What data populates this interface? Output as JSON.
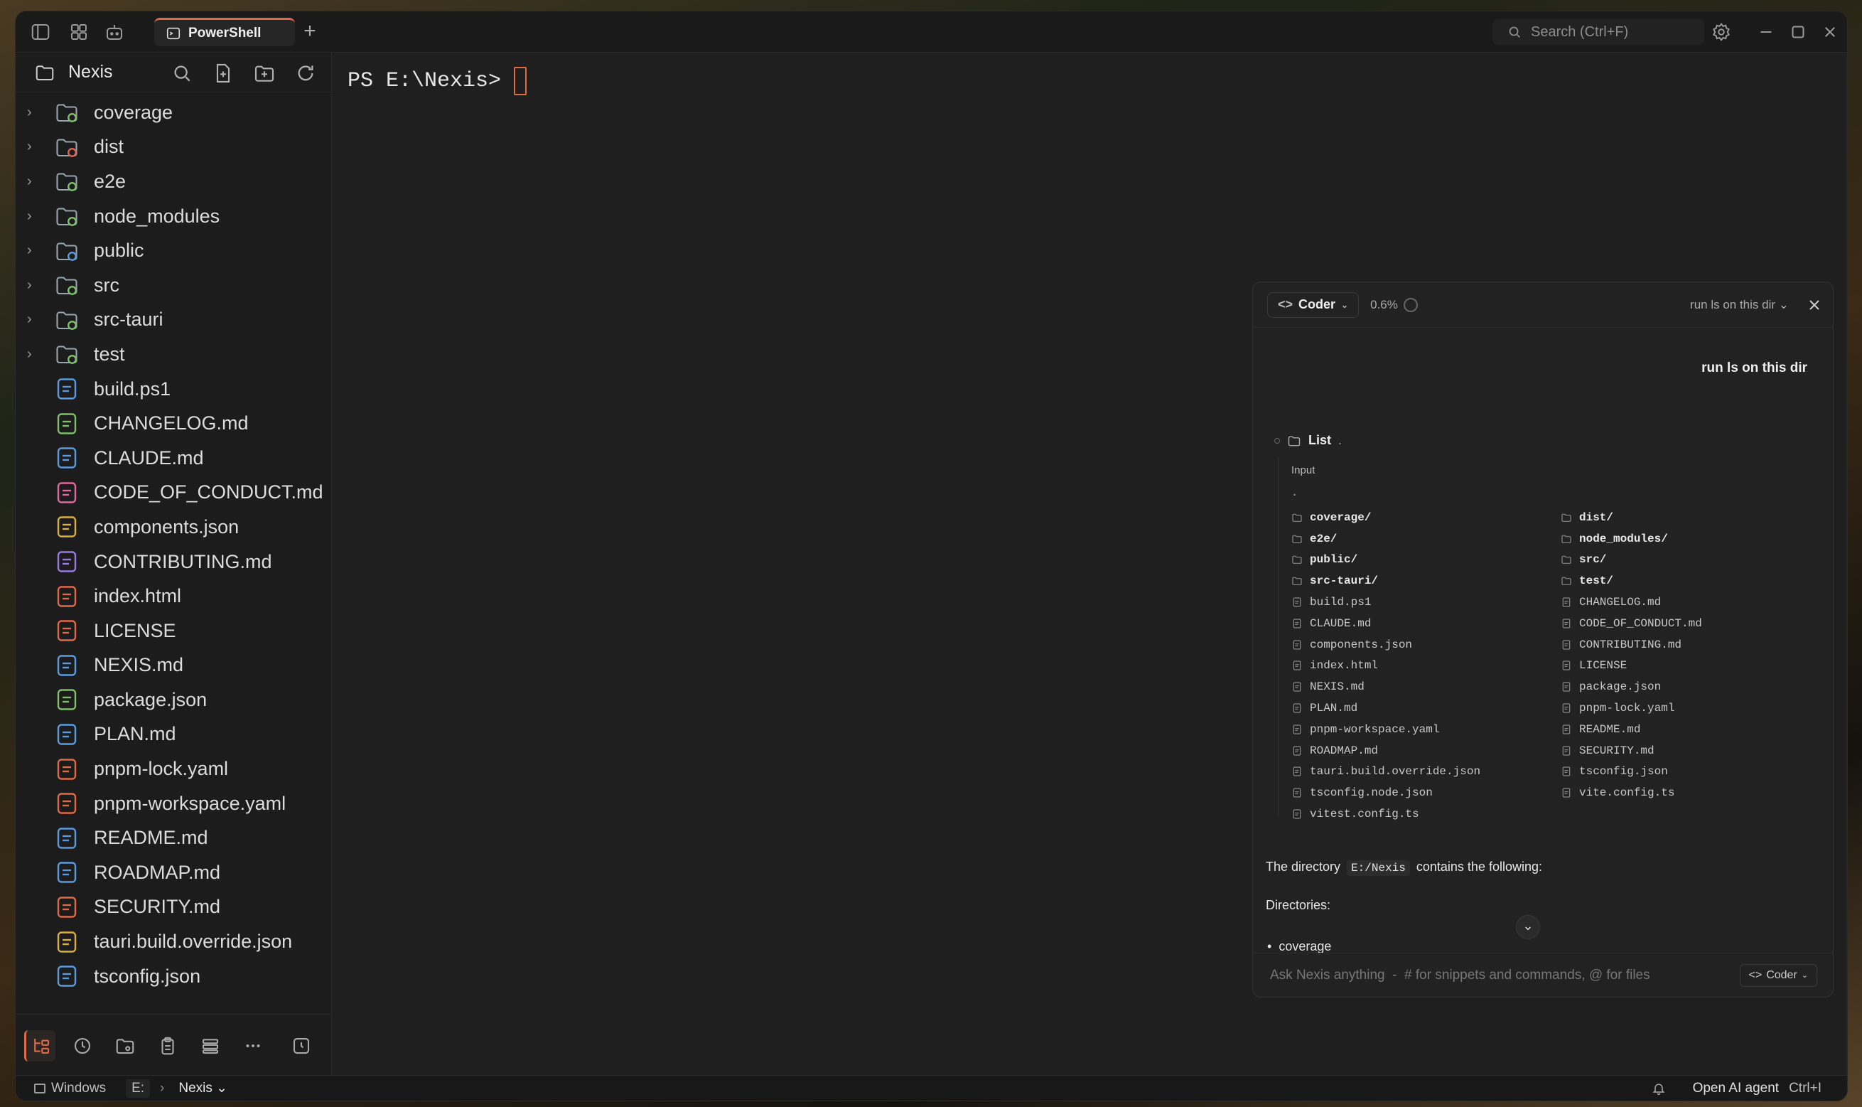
{
  "titlebar": {
    "tab_label": "PowerShell",
    "search_placeholder": "Search (Ctrl+F)"
  },
  "sidebar": {
    "folder_name": "Nexis",
    "items": [
      {
        "name": "coverage",
        "kind": "folder",
        "color": "#7fbf6a"
      },
      {
        "name": "dist",
        "kind": "folder",
        "color": "#e0605a"
      },
      {
        "name": "e2e",
        "kind": "folder",
        "color": "#7fbf6a"
      },
      {
        "name": "node_modules",
        "kind": "folder",
        "color": "#7fbf6a"
      },
      {
        "name": "public",
        "kind": "folder",
        "color": "#5a9be0"
      },
      {
        "name": "src",
        "kind": "folder",
        "color": "#7fbf6a"
      },
      {
        "name": "src-tauri",
        "kind": "folder",
        "color": "#7fbf6a"
      },
      {
        "name": "test",
        "kind": "folder",
        "color": "#7fbf6a"
      },
      {
        "name": "build.ps1",
        "kind": "file",
        "color": "#5a9be0"
      },
      {
        "name": "CHANGELOG.md",
        "kind": "file",
        "color": "#7fbf6a"
      },
      {
        "name": "CLAUDE.md",
        "kind": "file",
        "color": "#5a9be0"
      },
      {
        "name": "CODE_OF_CONDUCT.md",
        "kind": "file",
        "color": "#e06aa0"
      },
      {
        "name": "components.json",
        "kind": "file",
        "color": "#d9b03c"
      },
      {
        "name": "CONTRIBUTING.md",
        "kind": "file",
        "color": "#9a7ae0"
      },
      {
        "name": "index.html",
        "kind": "file",
        "color": "#e06a46"
      },
      {
        "name": "LICENSE",
        "kind": "file",
        "color": "#e06a46"
      },
      {
        "name": "NEXIS.md",
        "kind": "file",
        "color": "#5a9be0"
      },
      {
        "name": "package.json",
        "kind": "file",
        "color": "#7fbf6a"
      },
      {
        "name": "PLAN.md",
        "kind": "file",
        "color": "#5a9be0"
      },
      {
        "name": "pnpm-lock.yaml",
        "kind": "file",
        "color": "#e06a46"
      },
      {
        "name": "pnpm-workspace.yaml",
        "kind": "file",
        "color": "#e06a46"
      },
      {
        "name": "README.md",
        "kind": "file",
        "color": "#5a9be0"
      },
      {
        "name": "ROADMAP.md",
        "kind": "file",
        "color": "#5a9be0"
      },
      {
        "name": "SECURITY.md",
        "kind": "file",
        "color": "#e06a46"
      },
      {
        "name": "tauri.build.override.json",
        "kind": "file",
        "color": "#d9b03c"
      },
      {
        "name": "tsconfig.json",
        "kind": "file",
        "color": "#5a9be0"
      }
    ]
  },
  "terminal": {
    "prompt": "PS E:\\Nexis>"
  },
  "chat": {
    "mode": "Coder",
    "usage": "0.6%",
    "session_title": "run ls on this dir",
    "user_message": "run ls on this dir",
    "tool": {
      "name": "List",
      "arg": ".",
      "input_label": "Input",
      "input_value": "."
    },
    "listing_left": [
      {
        "name": "coverage/",
        "dir": true
      },
      {
        "name": "e2e/",
        "dir": true
      },
      {
        "name": "public/",
        "dir": true
      },
      {
        "name": "src-tauri/",
        "dir": true
      },
      {
        "name": "build.ps1"
      },
      {
        "name": "CLAUDE.md"
      },
      {
        "name": "components.json"
      },
      {
        "name": "index.html"
      },
      {
        "name": "NEXIS.md"
      },
      {
        "name": "PLAN.md"
      },
      {
        "name": "pnpm-workspace.yaml"
      },
      {
        "name": "ROADMAP.md"
      },
      {
        "name": "tauri.build.override.json"
      },
      {
        "name": "tsconfig.node.json"
      },
      {
        "name": "vitest.config.ts"
      }
    ],
    "listing_right": [
      {
        "name": "dist/",
        "dir": true
      },
      {
        "name": "node_modules/",
        "dir": true
      },
      {
        "name": "src/",
        "dir": true
      },
      {
        "name": "test/",
        "dir": true
      },
      {
        "name": "CHANGELOG.md"
      },
      {
        "name": "CODE_OF_CONDUCT.md"
      },
      {
        "name": "CONTRIBUTING.md"
      },
      {
        "name": "LICENSE"
      },
      {
        "name": "package.json"
      },
      {
        "name": "pnpm-lock.yaml"
      },
      {
        "name": "README.md"
      },
      {
        "name": "SECURITY.md"
      },
      {
        "name": "tsconfig.json"
      },
      {
        "name": "vite.config.ts"
      }
    ],
    "reply_pre": "The directory",
    "reply_path": "E:/Nexis",
    "reply_post": "contains the following:",
    "reply_heading": "Directories:",
    "reply_bullet": "coverage",
    "input_placeholder": "Ask Nexis anything  -  # for snippets and commands, @ for files",
    "input_mode": "Coder"
  },
  "statusbar": {
    "os": "Windows",
    "drive": "E:",
    "folder": "Nexis",
    "ai_label": "Open AI agent",
    "ai_shortcut": "Ctrl+I"
  }
}
